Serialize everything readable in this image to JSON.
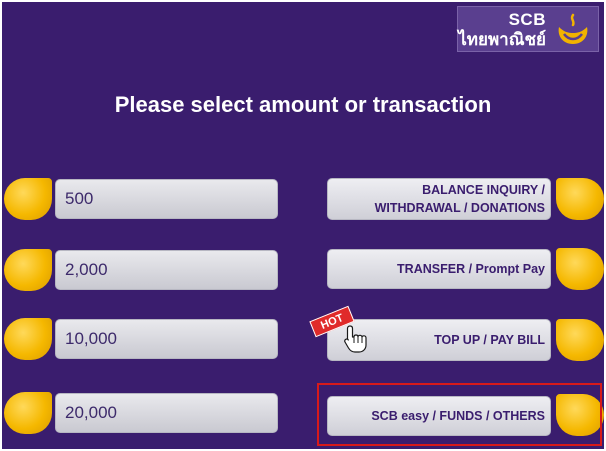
{
  "logo": {
    "name_en": "SCB",
    "name_th": "ไทยพาณิชย์",
    "icon": "scb-lamp-icon"
  },
  "title": "Please select amount or transaction",
  "amounts": [
    {
      "label": "500"
    },
    {
      "label": "2,000"
    },
    {
      "label": "10,000"
    },
    {
      "label": "20,000"
    }
  ],
  "transactions": [
    {
      "line1": "BALANCE INQUIRY /",
      "line2": "WITHDRAWAL / DONATIONS"
    },
    {
      "part1": "TRANSFER",
      "part2": " / Prompt Pay"
    },
    {
      "label": "TOP UP / PAY BILL",
      "badge": "HOT",
      "icon": "pointing-hand-icon"
    },
    {
      "label": "SCB easy / FUNDS / OTHERS"
    }
  ],
  "colors": {
    "background": "#3a1d6e",
    "key_gold": "#f5b800",
    "button_gray": "#d8d8de",
    "highlight": "#d71a1a",
    "hot_badge": "#e02a2a"
  }
}
